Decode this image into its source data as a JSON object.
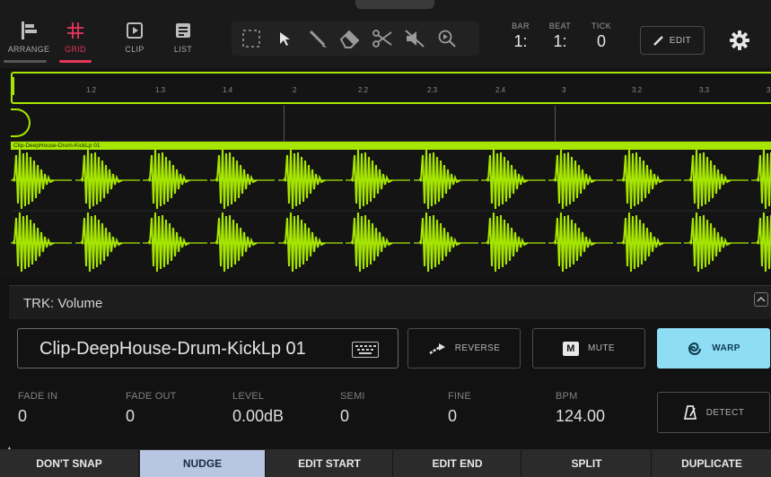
{
  "topbar": {
    "modes": [
      {
        "label": "ARRANGE",
        "icon": "arrange-icon",
        "active": false
      },
      {
        "label": "GRID",
        "icon": "grid-icon",
        "active": true
      },
      {
        "label": "CLIP",
        "icon": "clip-icon",
        "active": false
      },
      {
        "label": "LIST",
        "icon": "list-icon",
        "active": false
      }
    ],
    "tools": [
      "select-region-icon",
      "pointer-icon",
      "pencil-icon",
      "eraser-icon",
      "scissors-icon",
      "mute-tool-icon",
      "zoom-icon"
    ],
    "counters": [
      {
        "header": "BAR",
        "value": "1:"
      },
      {
        "header": "BEAT",
        "value": "1:"
      },
      {
        "header": "TICK",
        "value": "0"
      }
    ],
    "edit_label": "EDIT"
  },
  "timeline": {
    "ruler_ticks": [
      "1.2",
      "1.3",
      "1.4",
      "2",
      "2.2",
      "2.3",
      "2.4",
      "3",
      "3.2",
      "3.3",
      "3"
    ],
    "clip_label": "Clip-DeepHouse-Drum-KickLp 01"
  },
  "track_param": "TRK: Volume",
  "clip": {
    "name": "Clip-DeepHouse-Drum-KickLp 01",
    "reverse_label": "REVERSE",
    "mute_badge": "M",
    "mute_label": "MUTE",
    "warp_label": "WARP",
    "detect_label": "DETECT"
  },
  "params": [
    {
      "header": "FADE IN",
      "value": "0"
    },
    {
      "header": "FADE OUT",
      "value": "0"
    },
    {
      "header": "LEVEL",
      "value": "0.00dB"
    },
    {
      "header": "SEMI",
      "value": "0"
    },
    {
      "header": "FINE",
      "value": "0"
    },
    {
      "header": "BPM",
      "value": "124.00"
    }
  ],
  "bottom": {
    "buttons": [
      {
        "label": "DON'T SNAP",
        "active": false
      },
      {
        "label": "NUDGE",
        "active": true
      },
      {
        "label": "EDIT START",
        "active": false
      },
      {
        "label": "EDIT END",
        "active": false
      },
      {
        "label": "SPLIT",
        "active": false
      },
      {
        "label": "DUPLICATE",
        "active": false
      }
    ]
  },
  "colors": {
    "accent_grid": "#e8365a",
    "clip_green": "#a6e600",
    "warp_blue": "#8fdcf5",
    "nudge_active": "#b8c6e3"
  }
}
